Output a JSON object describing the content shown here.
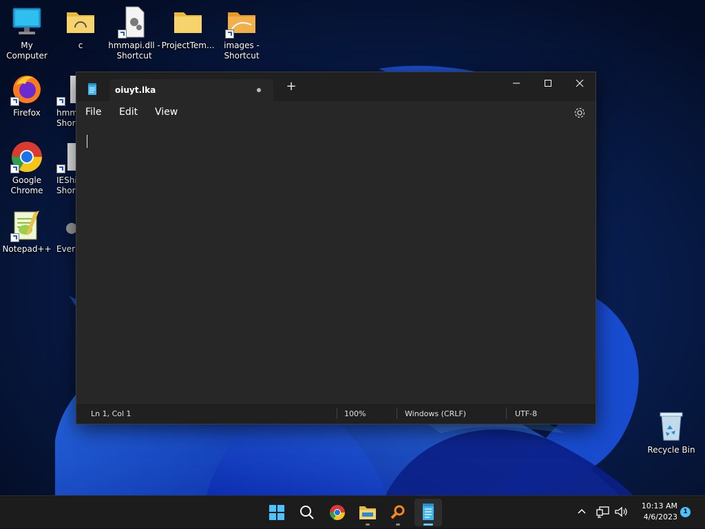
{
  "desktop": {
    "icons": [
      {
        "label": "My Computer"
      },
      {
        "label": "c"
      },
      {
        "label": "hmmapi.dll -\nShortcut"
      },
      {
        "label": "ProjectTem..."
      },
      {
        "label": "images -\nShortcut"
      },
      {
        "label": "Firefox"
      },
      {
        "label": "Google\nChrome"
      },
      {
        "label": "Notepad++"
      },
      {
        "label": "Recycle Bin"
      }
    ],
    "partial_icons": [
      {
        "label": "hmm\nShor"
      },
      {
        "label": "IEShi\nShor"
      },
      {
        "label": "Ever"
      }
    ]
  },
  "notepad": {
    "tab_title": "oiuyt.lka",
    "new_tab_symbol": "+",
    "controls": {
      "minimize": "—",
      "maximize": "☐",
      "close": "✕"
    },
    "menus": [
      "File",
      "Edit",
      "View"
    ],
    "content": "",
    "status": {
      "position": "Ln 1, Col 1",
      "zoom": "100%",
      "line_ending": "Windows (CRLF)",
      "encoding": "UTF-8"
    }
  },
  "taskbar": {
    "apps": [
      "start",
      "search",
      "chrome",
      "file-explorer",
      "search-tool",
      "notepad"
    ],
    "clock_time": "10:13 AM",
    "clock_date": "4/6/2023",
    "notification_count": "1"
  },
  "colors": {
    "accent": "#60cdff",
    "window_bg": "#272727",
    "titlebar_bg": "#202020",
    "taskbar_bg": "#1c1c1c"
  }
}
